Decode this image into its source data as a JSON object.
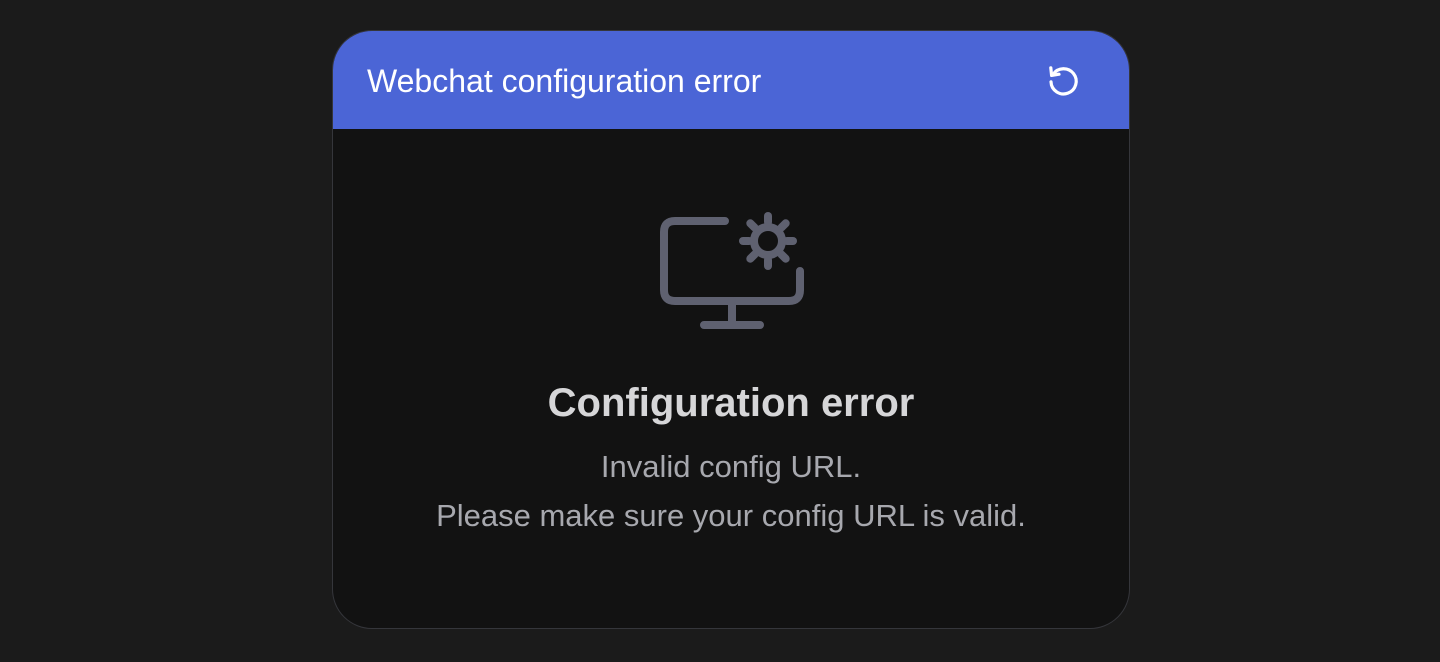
{
  "header": {
    "title": "Webchat configuration error",
    "refresh_icon": "refresh-icon",
    "background_color": "#4b65d6"
  },
  "error": {
    "icon": "monitor-settings-icon",
    "title": "Configuration error",
    "message_line_1": "Invalid config URL.",
    "message_line_2": "Please make sure your config URL is valid.",
    "icon_color": "#5f6170"
  }
}
